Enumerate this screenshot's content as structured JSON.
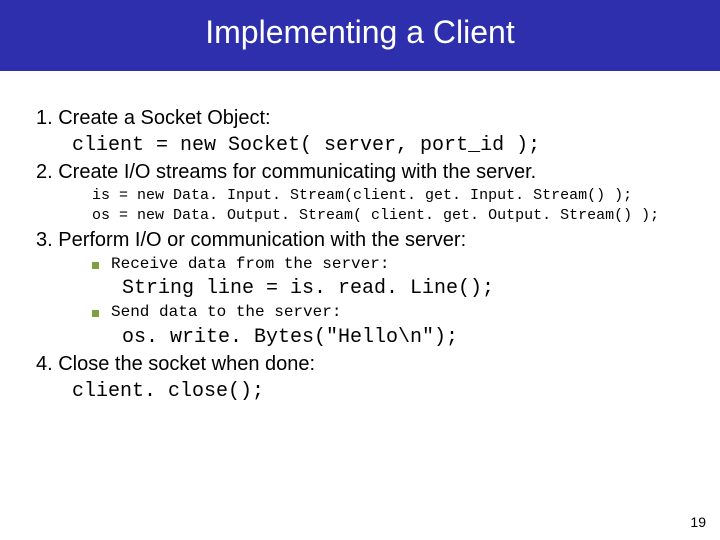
{
  "title": "Implementing a Client",
  "step1": {
    "text": "1. Create a Socket Object:",
    "code": "client = new Socket( server, port_id );"
  },
  "step2": {
    "text": "2. Create I/O streams for communicating with the server.",
    "code1": "is = new Data. Input. Stream(client. get. Input. Stream() );",
    "code2": "os = new Data. Output. Stream( client. get. Output. Stream() );"
  },
  "step3": {
    "text": "3. Perform I/O or communication with the server:",
    "bullet1": {
      "label": "Receive data from the server:",
      "code": "String line = is. read. Line();"
    },
    "bullet2": {
      "label": "Send data to the server:",
      "code": "os. write. Bytes(\"Hello\\n\");"
    }
  },
  "step4": {
    "text": "4. Close the socket when done:",
    "code": "client. close();"
  },
  "page_number": "19"
}
